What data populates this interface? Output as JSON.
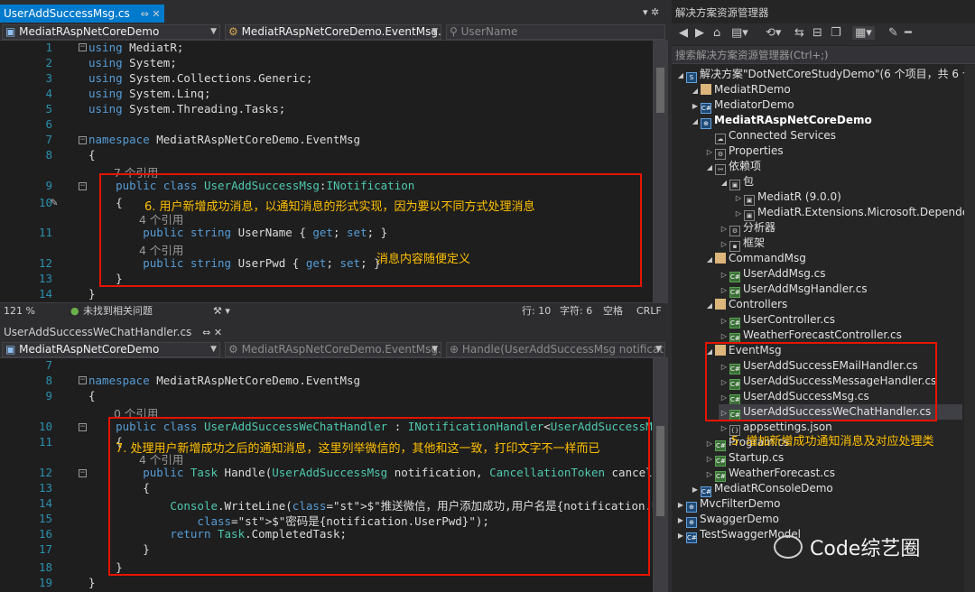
{
  "top_tab": {
    "label": "UserAddSuccessMsg.cs",
    "pin": "⇔",
    "close": "✕"
  },
  "top_nav": {
    "project": "MediatRAspNetCoreDemo",
    "class": "MediatRAspNetCoreDemo.EventMsg.Us",
    "member": "UserName"
  },
  "top_lines": [
    {
      "n": "1",
      "t": "using MediatR;"
    },
    {
      "n": "2",
      "t": "using System;"
    },
    {
      "n": "3",
      "t": "using System.Collections.Generic;"
    },
    {
      "n": "4",
      "t": "using System.Linq;"
    },
    {
      "n": "5",
      "t": "using System.Threading.Tasks;"
    },
    {
      "n": "6",
      "t": ""
    },
    {
      "n": "7",
      "t": "namespace MediatRAspNetCoreDemo.EventMsg"
    },
    {
      "n": "8",
      "t": "{"
    },
    {
      "n": "9",
      "t": "    public class UserAddSuccessMsg:INotification"
    },
    {
      "n": "10",
      "t": "    {"
    },
    {
      "n": "11",
      "t": "        public string UserName { get; set; }"
    },
    {
      "n": "12",
      "t": "        public string UserPwd { get; set; }"
    },
    {
      "n": "13",
      "t": "    }"
    },
    {
      "n": "14",
      "t": "}"
    }
  ],
  "top_refs": {
    "r1": "7 个引用",
    "r2": "4 个引用",
    "r3": "4 个引用"
  },
  "top_notes": {
    "n6": "6. 用户新增成功消息，以通知消息的形式实现，因为要以不同方式处理消息",
    "content": "消息内容随便定义"
  },
  "status": {
    "zoom": "121 %",
    "issues": "未找到相关问题",
    "line": "行: 10",
    "char": "字符: 6",
    "space": "空格",
    "eol": "CRLF"
  },
  "bottom_tab": {
    "label": "UserAddSuccessWeChatHandler.cs",
    "pin": "⇔",
    "close": "✕"
  },
  "bottom_nav": {
    "project": "MediatRAspNetCoreDemo",
    "class": "MediatRAspNetCoreDemo.EventMsg.Us",
    "member": "Handle(UserAddSuccessMsg notification"
  },
  "bottom_lines": [
    {
      "n": "7",
      "t": ""
    },
    {
      "n": "8",
      "t": "namespace MediatRAspNetCoreDemo.EventMsg"
    },
    {
      "n": "9",
      "t": "{"
    },
    {
      "n": "10",
      "t": "    public class UserAddSuccessWeChatHandler : INotificationHandler<UserAddSuccessMsg>"
    },
    {
      "n": "11",
      "t": "    {"
    },
    {
      "n": "12",
      "t": "        public Task Handle(UserAddSuccessMsg notification, CancellationToken cancellatio"
    },
    {
      "n": "13",
      "t": "        {"
    },
    {
      "n": "14",
      "t": "            Console.WriteLine($\"推送微信，用户添加成功,用户名是{notification.UserName},"
    },
    {
      "n": "15",
      "t": "                $\"密码是{notification.UserPwd}\");"
    },
    {
      "n": "16",
      "t": "            return Task.CompletedTask;"
    },
    {
      "n": "17",
      "t": "        }"
    },
    {
      "n": "18",
      "t": "    }"
    },
    {
      "n": "19",
      "t": "}"
    }
  ],
  "bottom_refs": {
    "r1": "0 个引用",
    "r2": "4 个引用"
  },
  "bottom_note": "7. 处理用户新增成功之后的通知消息，这里列举微信的，其他和这一致，打印文字不一样而已",
  "solution_explorer": {
    "title": "解决方案资源管理器",
    "search_placeholder": "搜索解决方案资源管理器(Ctrl+;)",
    "items": [
      {
        "label": "解决方案\"DotNetCoreStudyDemo\"(6 个项目，共 6 个)",
        "icon": "solution-icon"
      },
      {
        "label": "MediatRDemo",
        "icon": "folder-icon"
      },
      {
        "label": "MediatorDemo",
        "icon": "csproj-icon"
      },
      {
        "label": "MediatRAspNetCoreDemo",
        "icon": "web-project-icon"
      },
      {
        "label": "Connected Services",
        "icon": "connected-services-icon"
      },
      {
        "label": "Properties",
        "icon": "properties-icon"
      },
      {
        "label": "依赖项",
        "icon": "dependencies-icon"
      },
      {
        "label": "包",
        "icon": "package-icon"
      },
      {
        "label": "MediatR (9.0.0)",
        "icon": "package-icon"
      },
      {
        "label": "MediatR.Extensions.Microsoft.DependencyI",
        "icon": "package-icon"
      },
      {
        "label": "分析器",
        "icon": "analyzer-icon"
      },
      {
        "label": "框架",
        "icon": "framework-icon"
      },
      {
        "label": "CommandMsg",
        "icon": "folder-icon"
      },
      {
        "label": "UserAddMsg.cs",
        "icon": "csharp-file-icon"
      },
      {
        "label": "UserAddMsgHandler.cs",
        "icon": "csharp-file-icon"
      },
      {
        "label": "Controllers",
        "icon": "folder-icon"
      },
      {
        "label": "UserController.cs",
        "icon": "csharp-file-icon"
      },
      {
        "label": "WeatherForecastController.cs",
        "icon": "csharp-file-icon"
      },
      {
        "label": "EventMsg",
        "icon": "folder-icon"
      },
      {
        "label": "UserAddSuccessEMailHandler.cs",
        "icon": "csharp-file-icon"
      },
      {
        "label": "UserAddSuccessMessageHandler.cs",
        "icon": "csharp-file-icon"
      },
      {
        "label": "UserAddSuccessMsg.cs",
        "icon": "csharp-file-icon"
      },
      {
        "label": "UserAddSuccessWeChatHandler.cs",
        "icon": "csharp-file-icon"
      },
      {
        "label": "appsettings.json",
        "icon": "json-file-icon"
      },
      {
        "label": "Program.cs",
        "icon": "csharp-file-icon"
      },
      {
        "label": "Startup.cs",
        "icon": "csharp-file-icon"
      },
      {
        "label": "WeatherForecast.cs",
        "icon": "csharp-file-icon"
      },
      {
        "label": "MediatRConsoleDemo",
        "icon": "csproj-icon"
      },
      {
        "label": "MvcFilterDemo",
        "icon": "web-project-icon"
      },
      {
        "label": "SwaggerDemo",
        "icon": "web-project-icon"
      },
      {
        "label": "TestSwaggerModel",
        "icon": "csproj-icon"
      }
    ],
    "note5": "5. 增加新增成功通知消息及对应处理类"
  },
  "watermark": "Code综艺圈",
  "colors": {
    "accent": "#007acc",
    "annotation": "#ffc000",
    "box": "#e51400",
    "keyword": "#569cd6",
    "type": "#4ec9b0"
  }
}
